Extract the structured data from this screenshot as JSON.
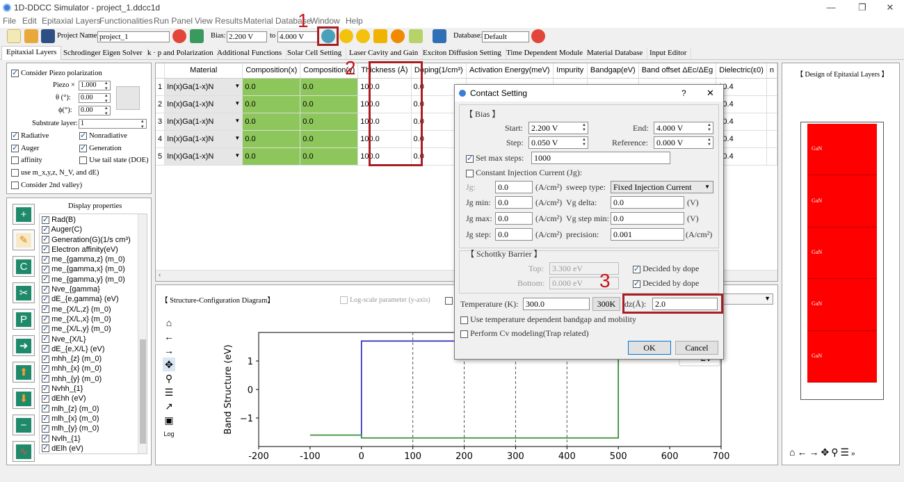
{
  "window": {
    "title": "1D-DDCC Simulator - project_1.ddcc1d"
  },
  "menu": [
    "File",
    "Edit",
    "Epitaxial Layers",
    "Functionalities",
    "Run Panel",
    "View Results",
    "Material Database",
    "Window",
    "Help"
  ],
  "toolbar": {
    "project_label": "Project Name:",
    "project_value": "project_1",
    "bias_label": "Bias:",
    "bias_start": "2.200 V",
    "to_label": "to",
    "bias_end": "4.000 V",
    "database_label": "Database:",
    "database_value": "Default"
  },
  "tabs": [
    "Epitaxial Layers",
    "Schrodinger Eigen Solver",
    "k · p and Polarization",
    "Additional Functions",
    "Solar Cell Setting",
    "Laser Cavity and Gain",
    "Exciton Diffusion Setting",
    "Time Dependent Module",
    "Material Database",
    "Input Editor"
  ],
  "left_panel": {
    "piezo_check": "Consider Piezo polarization",
    "piezo_label": "Piezo ×",
    "piezo_value": "1.000",
    "theta_label": "θ (°):",
    "theta_value": "0.00",
    "phi_label": "ϕ(°):",
    "phi_value": "0.00",
    "substrate_label": "Substrate layer:",
    "substrate_value": "1",
    "radiative": "Radiative",
    "nonradiative": "Nonradiative",
    "auger": "Auger",
    "generation": "Generation",
    "affinity": "affinity",
    "tail": "Use tail state (DOE)",
    "use_m": "use m_x,y,z, N_V, and dE)",
    "second_valley": "Consider 2nd valley)"
  },
  "display": {
    "title": "Display properties",
    "items": [
      "Rad(B)",
      "Auger(C)",
      "Generation(G)(1/s cm³)",
      "Electron affinity(eV)",
      "me_{gamma,z} (m_0)",
      "me_{gamma,x} (m_0)",
      "me_{gamma,y} (m_0)",
      "Nve_{gamma}",
      "dE_{e,gamma} (eV)",
      "me_{X/L,z} (m_0)",
      "me_{X/L,x} (m_0)",
      "me_{X/L,y} (m_0)",
      "Nve_{X/L}",
      "dE_{e,X/L} (eV)",
      "mhh_{z} (m_0)",
      "mhh_{x} (m_0)",
      "mhh_{y} (m_0)",
      "Nvhh_{1}",
      "dEhh (eV)",
      "mlh_{z} (m_0)",
      "mlh_{x} (m_0)",
      "mlh_{y} (m_0)",
      "Nvlh_{1}",
      "dElh (eV)"
    ]
  },
  "table": {
    "headers": [
      "Material",
      "Composition(x)",
      "Composition(y)",
      "Thickness (Å)",
      "Doping(1/cm³)",
      "Activation Energy(meV)",
      "Impurity",
      "Bandgap(eV)",
      "Band offset ΔEc/ΔEg",
      "Dielectric(ε0)",
      "n"
    ],
    "rows": [
      {
        "n": "1",
        "material": "In(x)Ga(1-x)N",
        "cx": "0.0",
        "cy": "0.0",
        "thick": "100.0",
        "doping": "0.0",
        "diel": "10.4"
      },
      {
        "n": "2",
        "material": "In(x)Ga(1-x)N",
        "cx": "0.0",
        "cy": "0.0",
        "thick": "100.0",
        "doping": "0.0",
        "diel": "10.4"
      },
      {
        "n": "3",
        "material": "In(x)Ga(1-x)N",
        "cx": "0.0",
        "cy": "0.0",
        "thick": "100.0",
        "doping": "0.0",
        "diel": "10.4"
      },
      {
        "n": "4",
        "material": "In(x)Ga(1-x)N",
        "cx": "0.0",
        "cy": "0.0",
        "thick": "100.0",
        "doping": "0.0",
        "diel": "10.4"
      },
      {
        "n": "5",
        "material": "In(x)Ga(1-x)N",
        "cx": "0.0",
        "cy": "0.0",
        "thick": "100.0",
        "doping": "0.0",
        "diel": "10.4"
      }
    ]
  },
  "structure": {
    "title": "【 Structure-Configuration Diagram】",
    "logscale": "Log-scale parameter (y-axis)",
    "log_label": "Log"
  },
  "design": {
    "title": "【 Design of Epitaxial Layers 】",
    "layer_label": "GaN",
    "layer_count": 5,
    "layer_color": "#ff0000"
  },
  "chart_data": {
    "type": "line",
    "xlabel": "",
    "ylabel": "Band Structure (eV)",
    "xlim": [
      -200,
      700
    ],
    "ylim": [
      -2.0,
      2.0
    ],
    "xticks": [
      -200,
      -100,
      0,
      100,
      200,
      300,
      400,
      500,
      600,
      700
    ],
    "yticks": [
      -1,
      0,
      1
    ],
    "layer_boundaries": [
      100,
      200,
      300,
      400
    ],
    "series": [
      {
        "name": "Ec",
        "color": "#1f1fbf",
        "x": [
          0,
          0,
          500,
          500
        ],
        "y": [
          -1.7,
          1.7,
          1.7,
          -1.7
        ]
      },
      {
        "name": "Ev",
        "color": "#2a8a2a",
        "x": [
          -100,
          0,
          0,
          500,
          500
        ],
        "y": [
          -1.6,
          -1.6,
          -1.7,
          -1.7,
          1.7
        ]
      }
    ]
  },
  "dialog": {
    "title": "Contact Setting",
    "help": "?",
    "close": "✕",
    "bias_group": "【 Bias 】",
    "start_label": "Start:",
    "start_value": "2.200 V",
    "end_label": "End:",
    "end_value": "4.000 V",
    "step_label": "Step:",
    "step_value": "0.050 V",
    "ref_label": "Reference:",
    "ref_value": "0.000 V",
    "maxsteps_label": "Set max steps:",
    "maxsteps_value": "1000",
    "cic_label": "Constant Injection Current (Jg):",
    "jg_label": "Jg:",
    "jg_value": "0.0",
    "unit_acm": "(A/cm²)",
    "sweep_label": "sweep type:",
    "sweep_value": "Fixed Injection Current",
    "jgmin_label": "Jg min:",
    "jgmin_value": "0.0",
    "vgdelta_label": "Vg delta:",
    "vgdelta_value": "0.0",
    "unit_v": "(V)",
    "jgmax_label": "Jg max:",
    "jgmax_value": "0.0",
    "vgstepmin_label": "Vg step min:",
    "vgstepmin_value": "0.0",
    "jgstep_label": "Jg step:",
    "jgstep_value": "0.0",
    "precision_label": "precision:",
    "precision_value": "0.001",
    "schottky_group": "【 Schottky Barrier 】",
    "top_label": "Top:",
    "top_value": "3.300 eV",
    "bottom_label": "Bottom:",
    "bottom_value": "0.000 eV",
    "decided": "Decided by dope",
    "temp_label": "Temperature (K):",
    "temp_value": "300.0",
    "k300": "300K",
    "dz_label": "dz(Å):",
    "dz_value": "2.0",
    "tempdep": "Use temperature dependent bandgap and mobility",
    "cv": "Perform Cv modeling(Trap related)",
    "ok": "OK",
    "cancel": "Cancel"
  },
  "annotations": [
    "1",
    "2",
    "3"
  ]
}
